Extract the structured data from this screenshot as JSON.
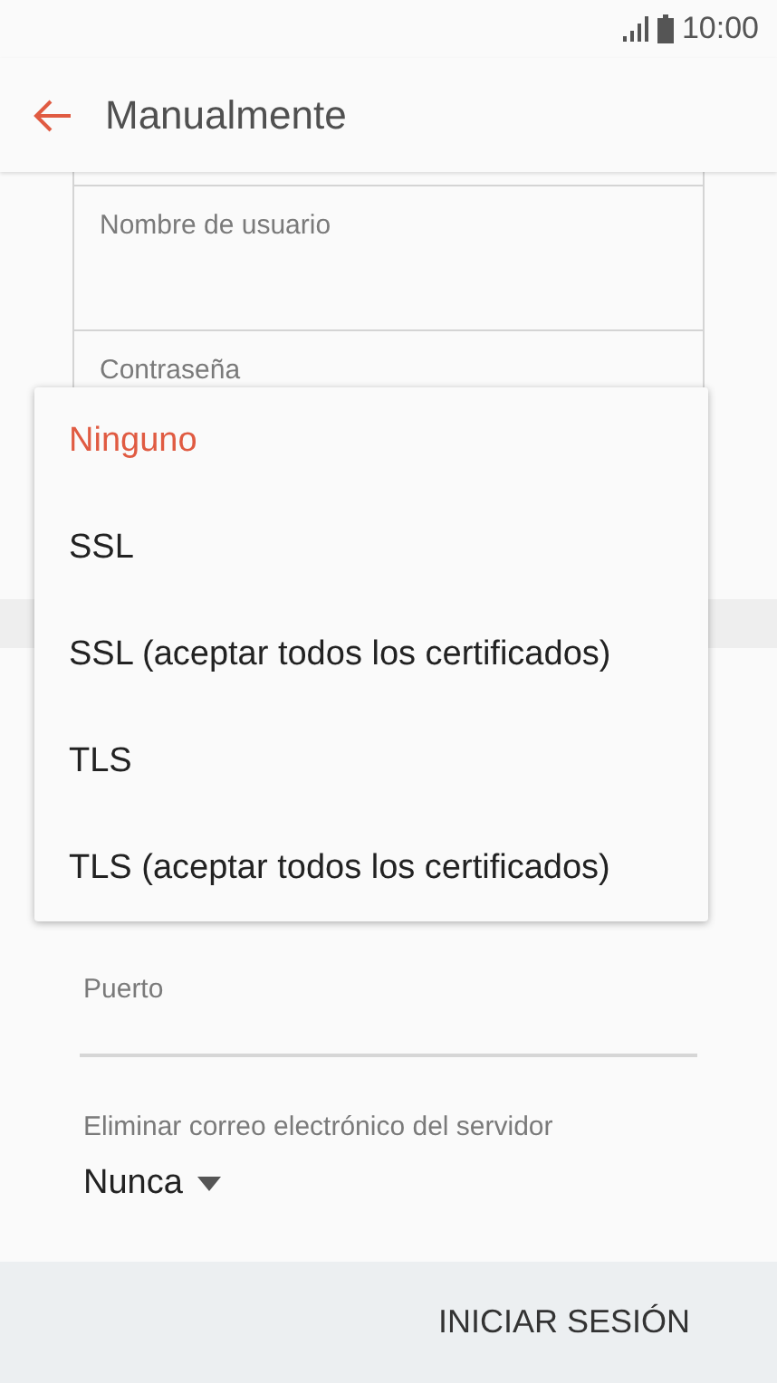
{
  "status_bar": {
    "time": "10:00"
  },
  "app_bar": {
    "title": "Manualmente"
  },
  "form": {
    "boxed_fields": [
      {
        "label": "Nombre de usuario"
      },
      {
        "label": "Contraseña"
      }
    ],
    "port_field": {
      "label": "Puerto"
    },
    "delete_setting": {
      "label": "Eliminar correo electrónico del servidor",
      "value": "Nunca"
    }
  },
  "dropdown": {
    "options": [
      {
        "label": "Ninguno",
        "selected": true
      },
      {
        "label": "SSL",
        "selected": false
      },
      {
        "label": "SSL (aceptar todos los certificados)",
        "selected": false
      },
      {
        "label": "TLS",
        "selected": false
      },
      {
        "label": "TLS (aceptar todos los certificados)",
        "selected": false
      }
    ]
  },
  "bottom_bar": {
    "button": "INICIAR SESIÓN"
  }
}
